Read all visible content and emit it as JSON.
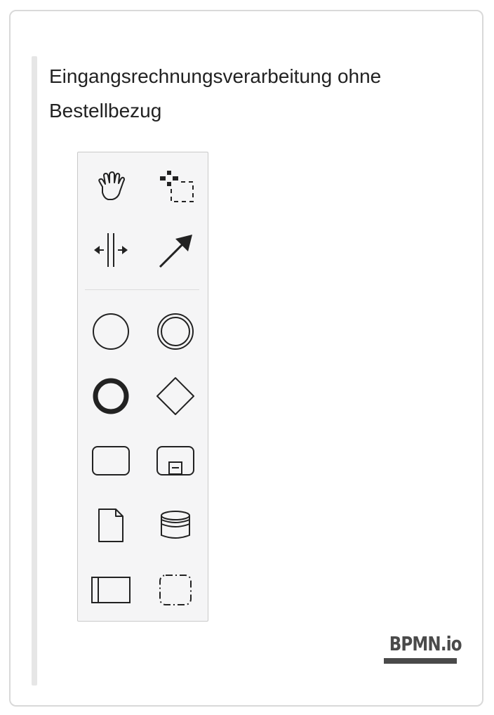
{
  "title": "Eingangsrechnungsverarbeitung ohne Bestellbezug",
  "logo": {
    "text": "BPMN.io"
  },
  "palette": {
    "tools": [
      {
        "name": "hand-tool",
        "icon": "hand-icon"
      },
      {
        "name": "lasso-tool",
        "icon": "lasso-icon"
      },
      {
        "name": "space-tool",
        "icon": "space-icon"
      },
      {
        "name": "global-connect-tool",
        "icon": "connect-arrow-icon"
      },
      {
        "name": "create-start-event",
        "icon": "start-event-icon"
      },
      {
        "name": "create-intermediate-event",
        "icon": "intermediate-event-icon"
      },
      {
        "name": "create-end-event",
        "icon": "end-event-icon"
      },
      {
        "name": "create-gateway",
        "icon": "gateway-icon"
      },
      {
        "name": "create-task",
        "icon": "task-icon"
      },
      {
        "name": "create-subprocess",
        "icon": "subprocess-icon"
      },
      {
        "name": "create-data-object",
        "icon": "data-object-icon"
      },
      {
        "name": "create-data-store",
        "icon": "data-store-icon"
      },
      {
        "name": "create-pool",
        "icon": "pool-icon"
      },
      {
        "name": "create-group",
        "icon": "group-icon"
      }
    ]
  },
  "colors": {
    "icon": "#222222",
    "palette_bg": "#f5f5f6",
    "quote_bar": "#e6e6e6"
  }
}
